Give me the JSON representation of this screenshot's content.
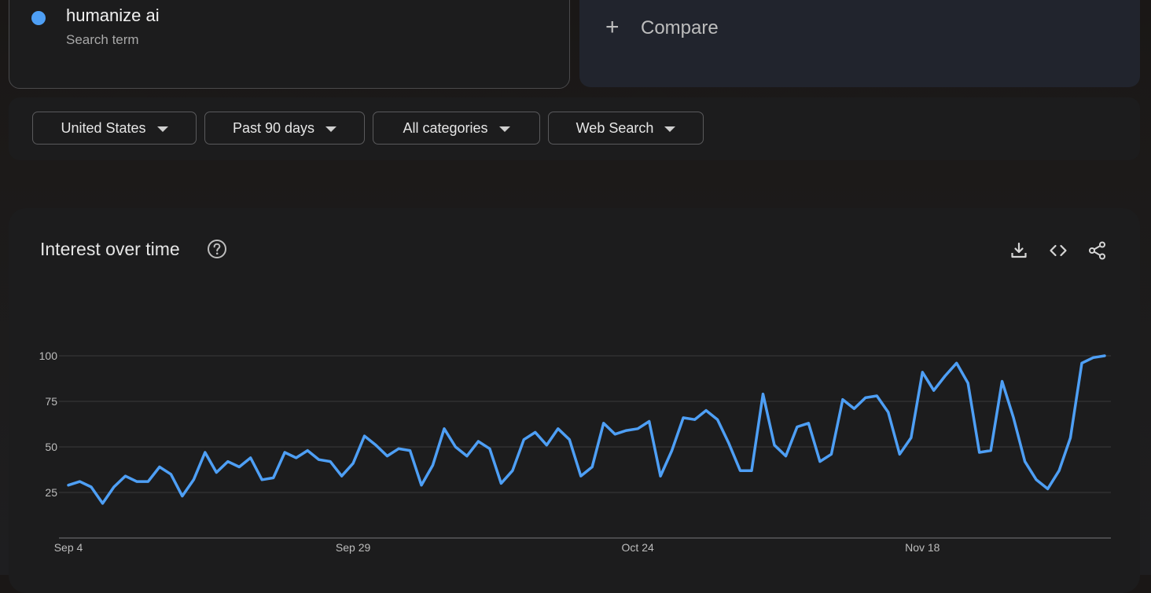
{
  "search_term": {
    "title": "humanize ai",
    "subtitle": "Search term",
    "color": "#4e9ff5"
  },
  "compare": {
    "icon": "plus-icon",
    "label": "Compare"
  },
  "filters": [
    {
      "label": "United States"
    },
    {
      "label": "Past 90 days"
    },
    {
      "label": "All categories"
    },
    {
      "label": "Web Search"
    }
  ],
  "interest": {
    "title": "Interest over time",
    "icons": [
      "help-icon",
      "download-icon",
      "embed-code-icon",
      "share-icon"
    ]
  },
  "chart_data": {
    "type": "line",
    "y_ticks": [
      100,
      75,
      50,
      25
    ],
    "x_ticks": [
      "Sep 4",
      "Sep 29",
      "Oct 24",
      "Nov 18"
    ],
    "ylim": [
      0,
      100
    ],
    "grid": true,
    "line_color": "#4e9ff5",
    "series": [
      {
        "values": [
          29,
          31,
          28,
          19,
          28,
          34,
          31,
          31,
          39,
          35,
          23,
          32,
          47,
          36,
          42,
          39,
          44,
          32,
          33,
          47,
          44,
          48,
          43,
          42,
          34,
          41,
          56,
          51,
          45,
          49,
          48,
          29,
          40,
          60,
          50,
          45,
          53,
          49,
          30,
          37,
          54,
          58,
          51,
          60,
          54,
          34,
          39,
          63,
          57,
          59,
          60,
          64,
          34,
          48,
          66,
          65,
          70,
          65,
          52,
          37,
          37,
          79,
          51,
          45,
          61,
          63,
          42,
          46,
          76,
          71,
          77,
          78,
          69,
          46,
          55,
          91,
          81,
          89,
          96,
          85,
          47,
          48,
          86,
          66,
          42,
          32,
          27,
          37,
          55,
          96,
          99,
          100
        ]
      }
    ]
  }
}
